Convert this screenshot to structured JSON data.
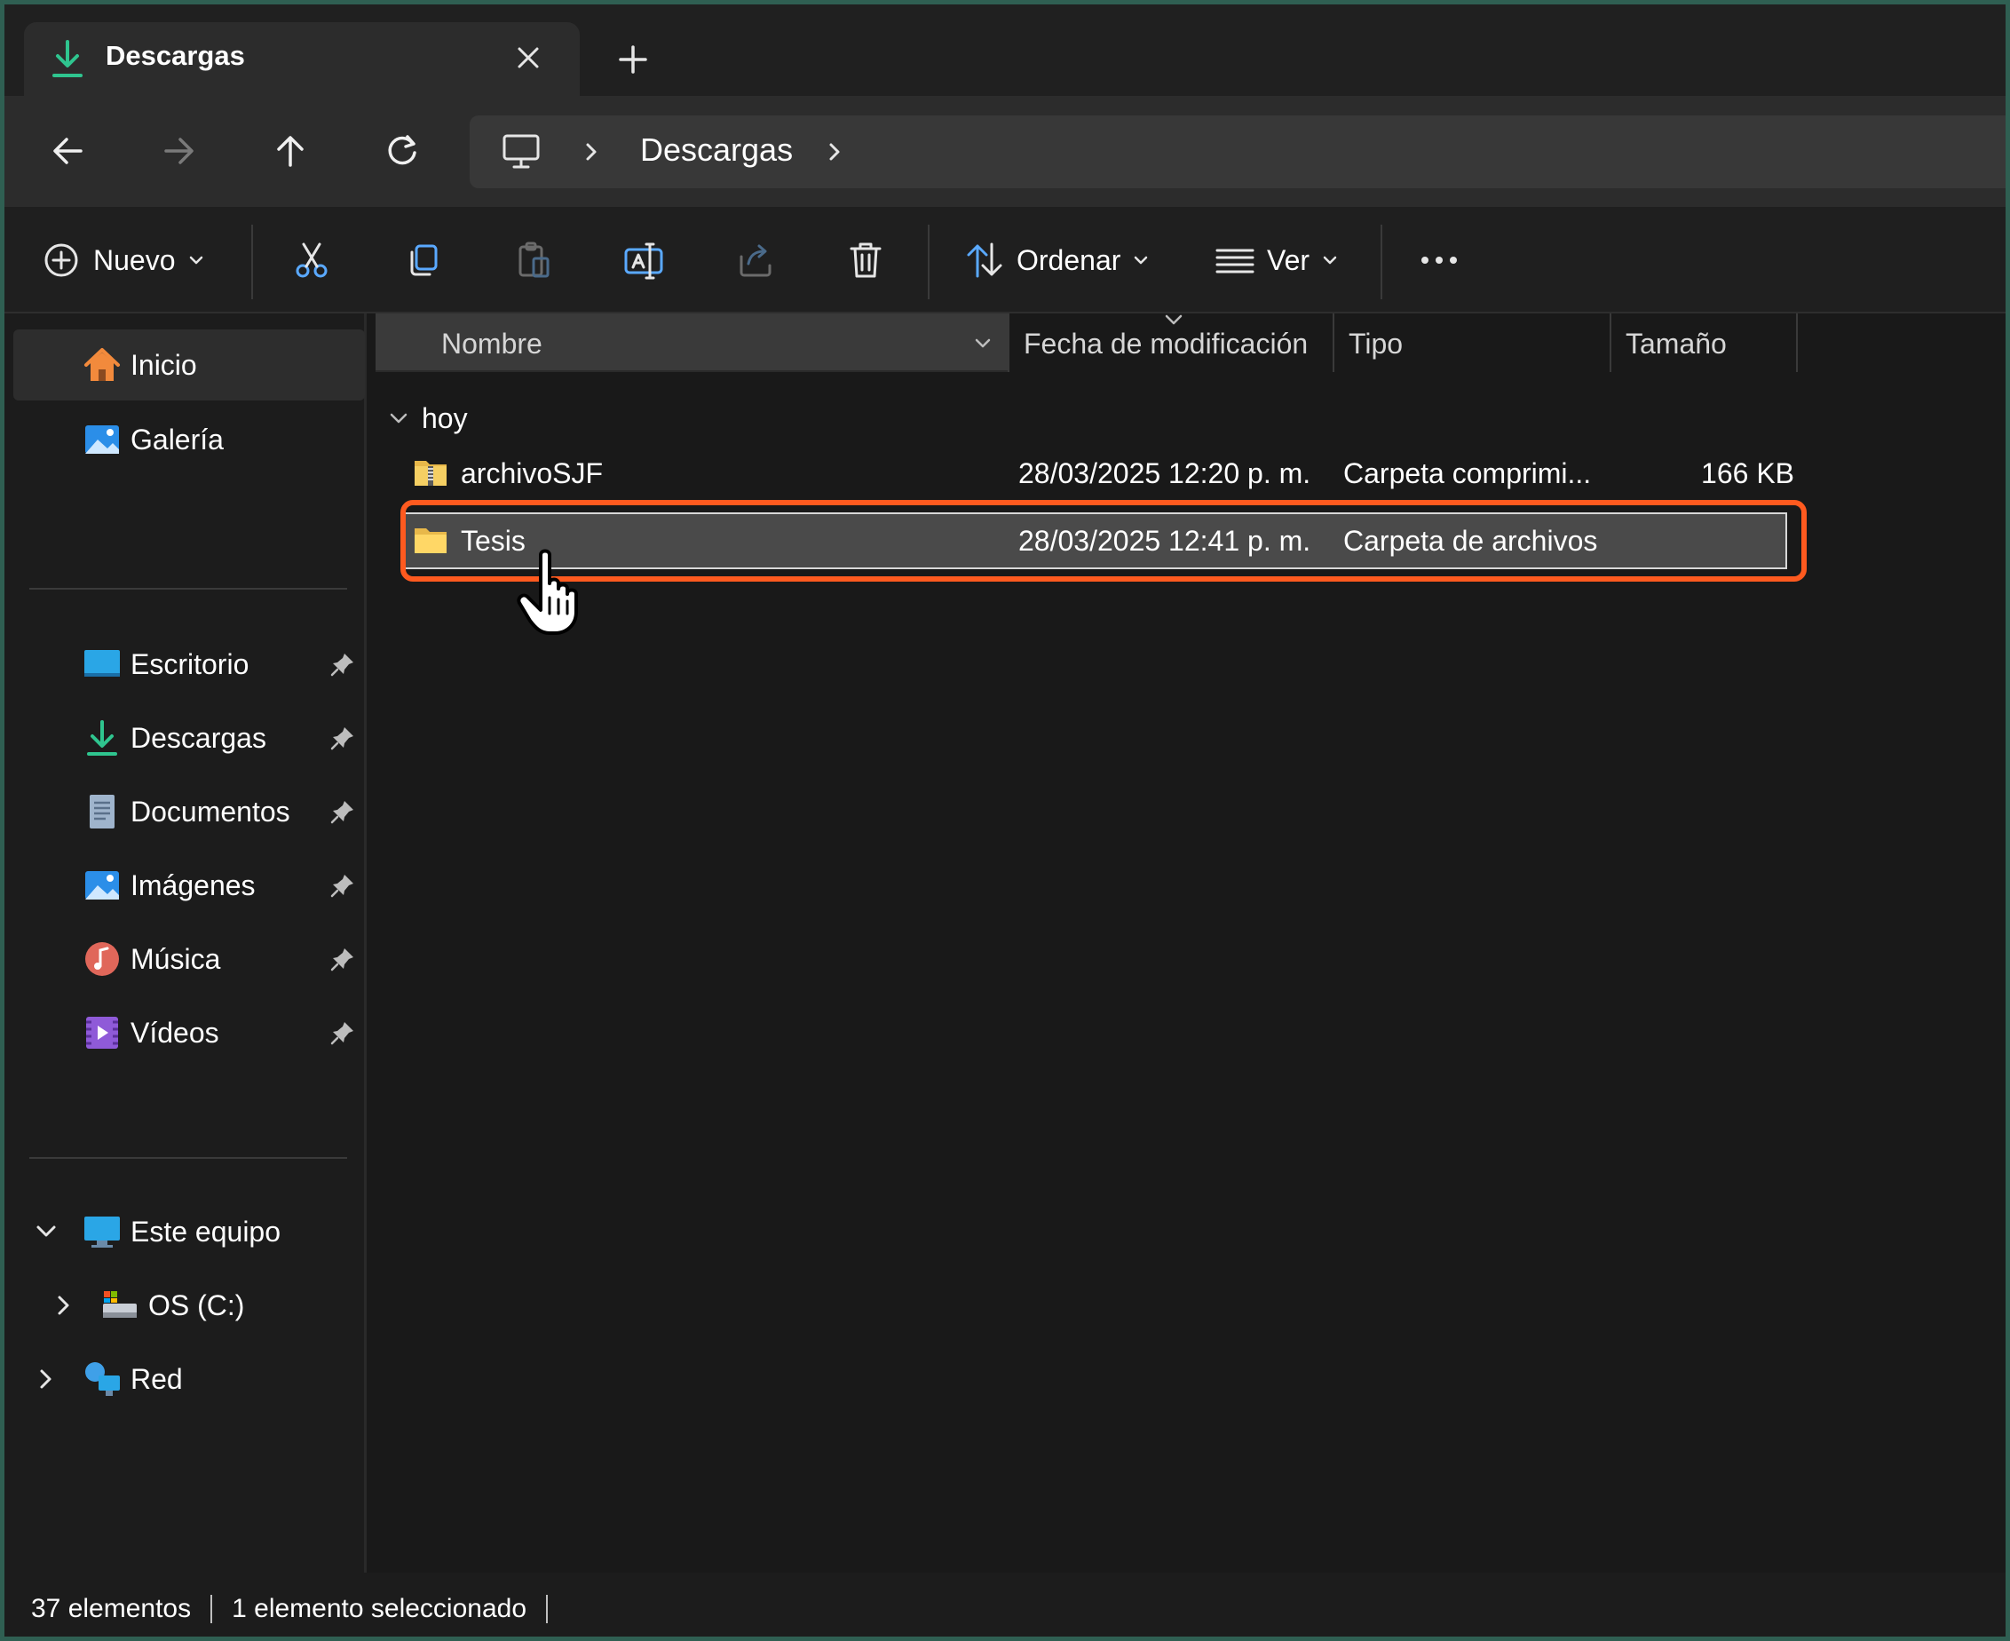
{
  "tab": {
    "title": "Descargas",
    "icon": "download-icon",
    "close_icon": "close-icon",
    "new_tab_icon": "plus-icon"
  },
  "nav": {
    "back_icon": "arrow-left-icon",
    "forward_icon": "arrow-right-icon",
    "up_icon": "arrow-up-icon",
    "refresh_icon": "refresh-icon",
    "breadcrumb": [
      "Descargas"
    ]
  },
  "toolbar": {
    "new_label": "Nuevo",
    "sort_label": "Ordenar",
    "view_label": "Ver",
    "icons": [
      "cut-icon",
      "copy-icon",
      "paste-icon",
      "rename-icon",
      "share-icon",
      "delete-icon",
      "more-icon"
    ]
  },
  "sidebar": {
    "top_items": [
      {
        "label": "Inicio",
        "icon": "home-icon"
      },
      {
        "label": "Galería",
        "icon": "gallery-icon"
      }
    ],
    "pinned_items": [
      {
        "label": "Escritorio",
        "icon": "desktop-icon"
      },
      {
        "label": "Descargas",
        "icon": "download-icon"
      },
      {
        "label": "Documentos",
        "icon": "documents-icon"
      },
      {
        "label": "Imágenes",
        "icon": "pictures-icon"
      },
      {
        "label": "Música",
        "icon": "music-icon"
      },
      {
        "label": "Vídeos",
        "icon": "videos-icon"
      }
    ],
    "tree": [
      {
        "label": "Este equipo",
        "icon": "computer-icon"
      },
      {
        "label": "OS (C:)",
        "icon": "drive-icon"
      },
      {
        "label": "Red",
        "icon": "network-icon"
      }
    ]
  },
  "columns": {
    "name": "Nombre",
    "date": "Fecha de modificación",
    "type": "Tipo",
    "size": "Tamaño"
  },
  "group": {
    "label": "hoy"
  },
  "files": [
    {
      "name": "archivoSJF",
      "date": "28/03/2025 12:20 p. m.",
      "type": "Carpeta comprimi...",
      "size": "166 KB",
      "icon": "zip-folder-icon"
    },
    {
      "name": "Tesis",
      "date": "28/03/2025 12:41 p. m.",
      "type": "Carpeta de archivos",
      "size": "",
      "icon": "folder-icon"
    }
  ],
  "status": {
    "count": "37 elementos",
    "selected": "1 elemento seleccionado"
  },
  "colors": {
    "accent_highlight": "#ff5a1f",
    "window_border": "#2f5f52",
    "download_green": "#2fc58f"
  }
}
